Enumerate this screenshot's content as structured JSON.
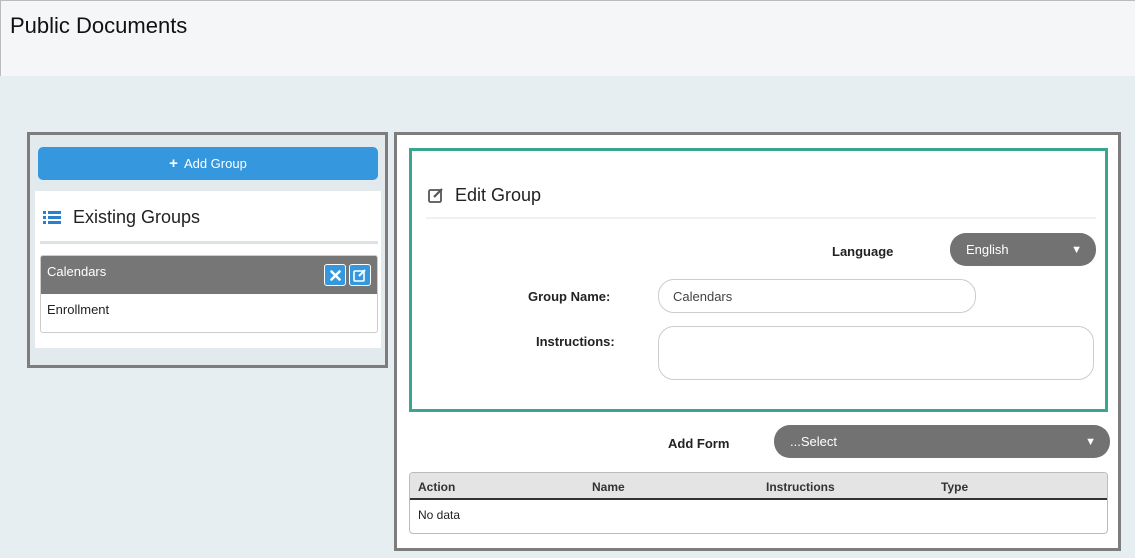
{
  "page": {
    "title": "Public Documents"
  },
  "left_panel": {
    "add_group_label": "Add Group",
    "existing_groups_title": "Existing Groups",
    "groups": [
      {
        "label": "Calendars",
        "active": true
      },
      {
        "label": "Enrollment",
        "active": false
      }
    ]
  },
  "edit_group": {
    "title": "Edit Group",
    "language_label": "Language",
    "language_value": "English",
    "group_name_label": "Group Name:",
    "group_name_value": "Calendars",
    "instructions_label": "Instructions:",
    "instructions_value": ""
  },
  "forms": {
    "add_form_label": "Add Form",
    "add_form_value": "...Select",
    "columns": [
      "Action",
      "Name",
      "Instructions",
      "Type"
    ],
    "empty_text": "No data"
  },
  "colors": {
    "primary_blue": "#3597de",
    "teal_border": "#3aa68f",
    "select_gray": "#727272",
    "panel_border": "#7d7d7d"
  }
}
